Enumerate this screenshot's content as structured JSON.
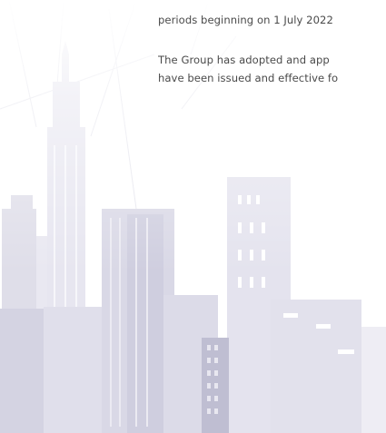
{
  "document": {
    "lines": [
      "periods beginning on 1 July 2022",
      "The Group has adopted and app",
      "have been issued and effective fo"
    ]
  }
}
